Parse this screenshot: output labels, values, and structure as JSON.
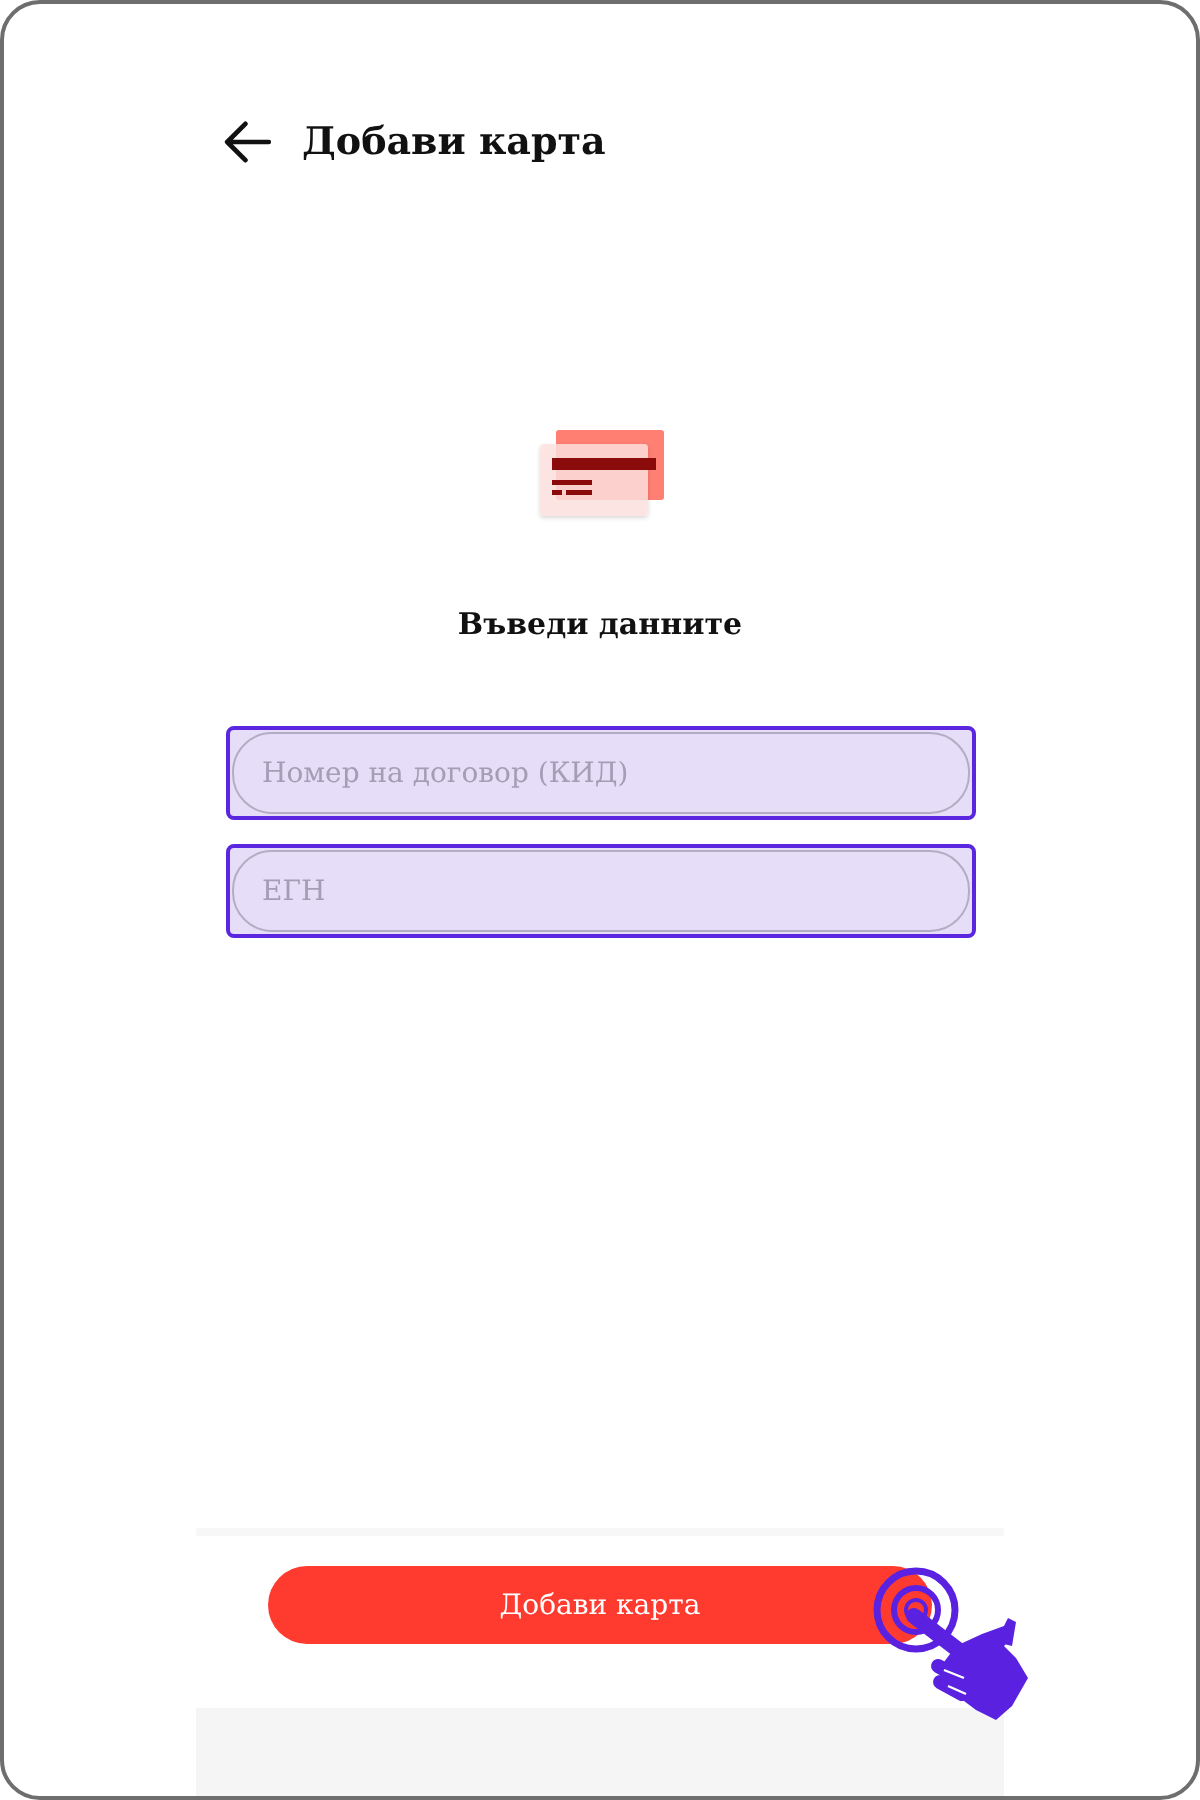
{
  "header": {
    "title": "Добави карта"
  },
  "form": {
    "heading": "Въведи данните",
    "fields": [
      {
        "placeholder": "Номер на договор (КИД)",
        "highlighted": true
      },
      {
        "placeholder": "ЕГН",
        "highlighted": true
      }
    ]
  },
  "footer": {
    "button": "Добави карта",
    "tap_hint": true
  }
}
